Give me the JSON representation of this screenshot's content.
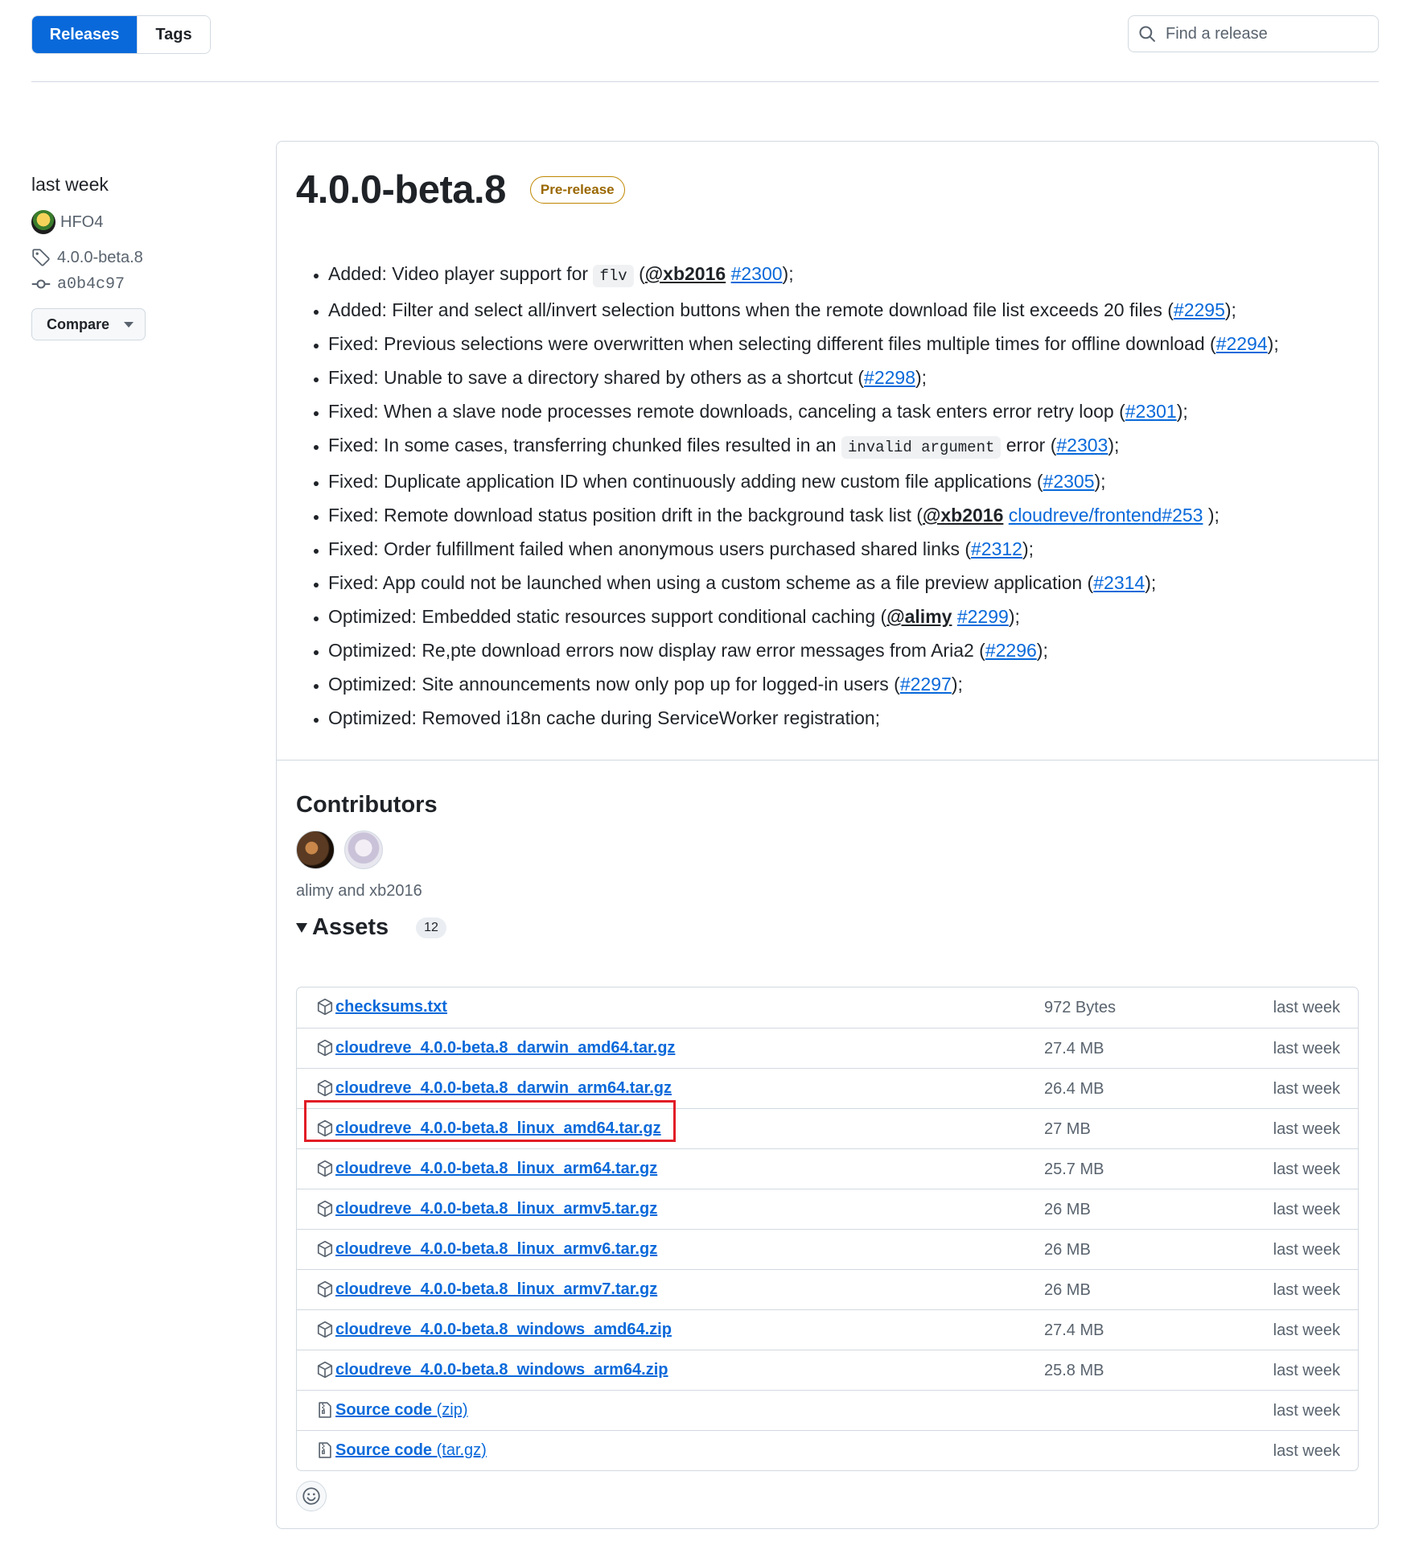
{
  "tabs": {
    "releases": "Releases",
    "tags": "Tags"
  },
  "search": {
    "placeholder": "Find a release"
  },
  "meta": {
    "time": "last week",
    "author": "HFO4",
    "tag": "4.0.0-beta.8",
    "commit": "a0b4c97",
    "compare_label": "Compare"
  },
  "release": {
    "title": "4.0.0-beta.8",
    "badge": "Pre-release"
  },
  "notes": [
    [
      {
        "t": "text",
        "v": "Added: Video player support for "
      },
      {
        "t": "code",
        "v": "flv"
      },
      {
        "t": "text",
        "v": " ("
      },
      {
        "t": "mention",
        "v": "@xb2016"
      },
      {
        "t": "text",
        "v": " "
      },
      {
        "t": "link",
        "v": "#2300"
      },
      {
        "t": "text",
        "v": ");"
      }
    ],
    [
      {
        "t": "text",
        "v": "Added: Filter and select all/invert selection buttons when the remote download file list exceeds 20 files ("
      },
      {
        "t": "link",
        "v": "#2295"
      },
      {
        "t": "text",
        "v": ");"
      }
    ],
    [
      {
        "t": "text",
        "v": "Fixed: Previous selections were overwritten when selecting different files multiple times for offline download ("
      },
      {
        "t": "link",
        "v": "#2294"
      },
      {
        "t": "text",
        "v": ");"
      }
    ],
    [
      {
        "t": "text",
        "v": "Fixed: Unable to save a directory shared by others as a shortcut ("
      },
      {
        "t": "link",
        "v": "#2298"
      },
      {
        "t": "text",
        "v": ");"
      }
    ],
    [
      {
        "t": "text",
        "v": "Fixed: When a slave node processes remote downloads, canceling a task enters error retry loop ("
      },
      {
        "t": "link",
        "v": "#2301"
      },
      {
        "t": "text",
        "v": ");"
      }
    ],
    [
      {
        "t": "text",
        "v": "Fixed: In some cases, transferring chunked files resulted in an "
      },
      {
        "t": "code",
        "v": "invalid argument"
      },
      {
        "t": "text",
        "v": " error ("
      },
      {
        "t": "link",
        "v": "#2303"
      },
      {
        "t": "text",
        "v": ");"
      }
    ],
    [
      {
        "t": "text",
        "v": "Fixed: Duplicate application ID when continuously adding new custom file applications ("
      },
      {
        "t": "link",
        "v": "#2305"
      },
      {
        "t": "text",
        "v": ");"
      }
    ],
    [
      {
        "t": "text",
        "v": "Fixed: Remote download status position drift in the background task list ("
      },
      {
        "t": "mention",
        "v": "@xb2016"
      },
      {
        "t": "text",
        "v": " "
      },
      {
        "t": "link",
        "v": "cloudreve/frontend#253"
      },
      {
        "t": "text",
        "v": " );"
      }
    ],
    [
      {
        "t": "text",
        "v": "Fixed: Order fulfillment failed when anonymous users purchased shared links ("
      },
      {
        "t": "link",
        "v": "#2312"
      },
      {
        "t": "text",
        "v": ");"
      }
    ],
    [
      {
        "t": "text",
        "v": "Fixed: App could not be launched when using a custom scheme as a file preview application ("
      },
      {
        "t": "link",
        "v": "#2314"
      },
      {
        "t": "text",
        "v": ");"
      }
    ],
    [
      {
        "t": "text",
        "v": "Optimized: Embedded static resources support conditional caching ("
      },
      {
        "t": "mention",
        "v": "@alimy"
      },
      {
        "t": "text",
        "v": " "
      },
      {
        "t": "link",
        "v": "#2299"
      },
      {
        "t": "text",
        "v": ");"
      }
    ],
    [
      {
        "t": "text",
        "v": "Optimized: Re,pte download errors now display raw error messages from Aria2 ("
      },
      {
        "t": "link",
        "v": "#2296"
      },
      {
        "t": "text",
        "v": ");"
      }
    ],
    [
      {
        "t": "text",
        "v": "Optimized: Site announcements now only pop up for logged-in users ("
      },
      {
        "t": "link",
        "v": "#2297"
      },
      {
        "t": "text",
        "v": ");"
      }
    ],
    [
      {
        "t": "text",
        "v": "Optimized: Removed i18n cache during ServiceWorker registration;"
      }
    ]
  ],
  "contributors": {
    "title": "Contributors",
    "names": "alimy and xb2016"
  },
  "assets": {
    "label": "Assets",
    "count": "12",
    "items": [
      {
        "name": "checksums.txt",
        "size": "972 Bytes",
        "time": "last week",
        "kind": "package"
      },
      {
        "name": "cloudreve_4.0.0-beta.8_darwin_amd64.tar.gz",
        "size": "27.4 MB",
        "time": "last week",
        "kind": "package"
      },
      {
        "name": "cloudreve_4.0.0-beta.8_darwin_arm64.tar.gz",
        "size": "26.4 MB",
        "time": "last week",
        "kind": "package"
      },
      {
        "name": "cloudreve_4.0.0-beta.8_linux_amd64.tar.gz",
        "size": "27 MB",
        "time": "last week",
        "kind": "package"
      },
      {
        "name": "cloudreve_4.0.0-beta.8_linux_arm64.tar.gz",
        "size": "25.7 MB",
        "time": "last week",
        "kind": "package"
      },
      {
        "name": "cloudreve_4.0.0-beta.8_linux_armv5.tar.gz",
        "size": "26 MB",
        "time": "last week",
        "kind": "package"
      },
      {
        "name": "cloudreve_4.0.0-beta.8_linux_armv6.tar.gz",
        "size": "26 MB",
        "time": "last week",
        "kind": "package"
      },
      {
        "name": "cloudreve_4.0.0-beta.8_linux_armv7.tar.gz",
        "size": "26 MB",
        "time": "last week",
        "kind": "package"
      },
      {
        "name": "cloudreve_4.0.0-beta.8_windows_amd64.zip",
        "size": "27.4 MB",
        "time": "last week",
        "kind": "package"
      },
      {
        "name": "cloudreve_4.0.0-beta.8_windows_arm64.zip",
        "size": "25.8 MB",
        "time": "last week",
        "kind": "package"
      },
      {
        "name": "Source code",
        "suffix": "(zip)",
        "size": "",
        "time": "last week",
        "kind": "file-zip"
      },
      {
        "name": "Source code",
        "suffix": "(tar.gz)",
        "size": "",
        "time": "last week",
        "kind": "file-zip"
      }
    ]
  },
  "colors": {
    "accent": "#0969da",
    "prerelease": "#9a6700",
    "highlight": "#e11d26"
  }
}
